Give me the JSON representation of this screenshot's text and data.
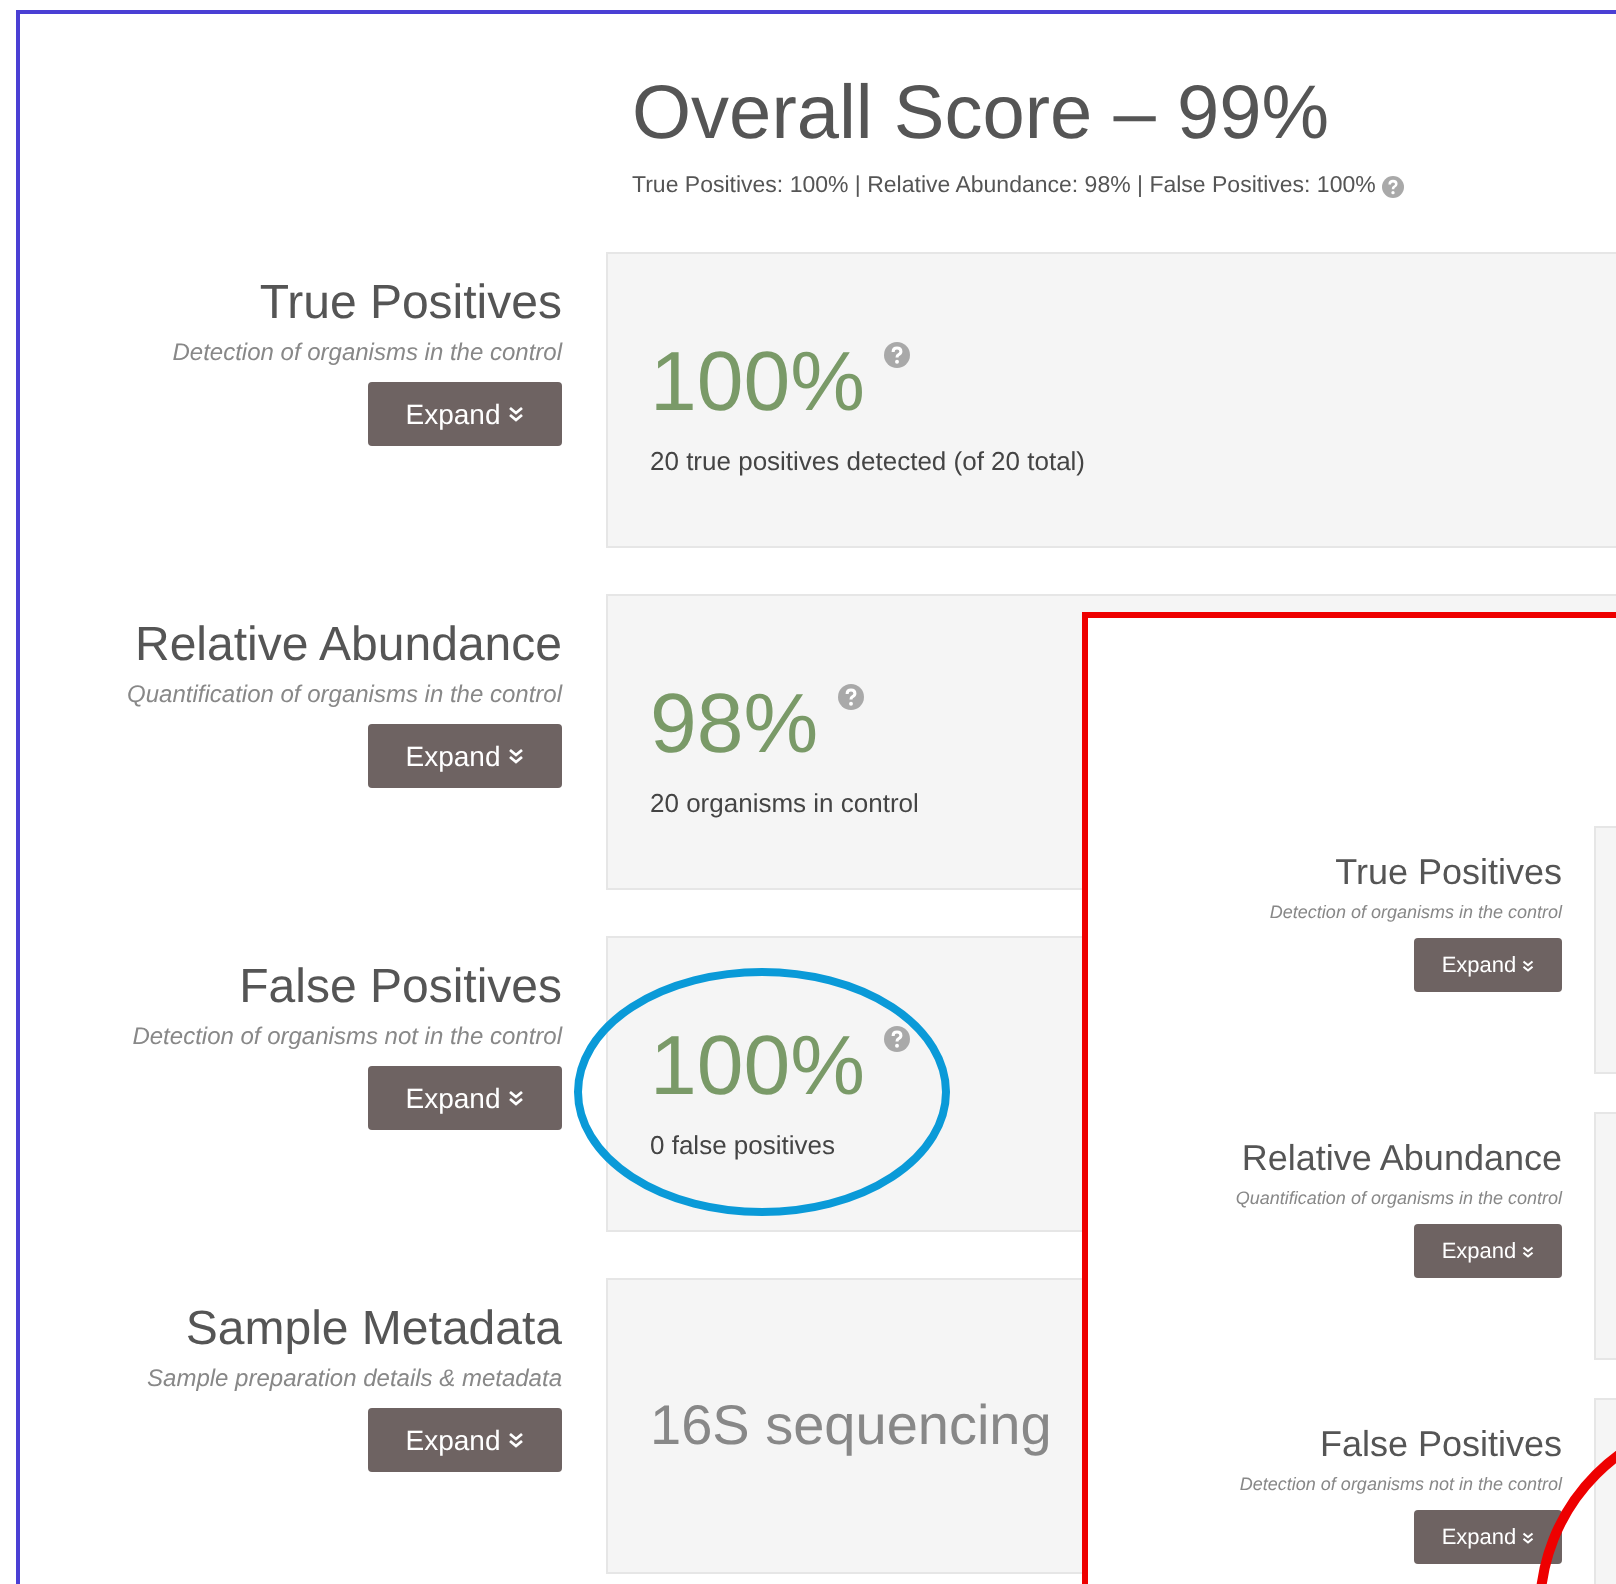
{
  "header": {
    "title": "Overall Score – 99%",
    "summary": "True Positives: 100% | Relative Abundance: 98% | False Positives: 100%"
  },
  "sections": [
    {
      "kind": "score",
      "title": "True Positives",
      "subtitle": "Detection of organisms in the control",
      "button": "Expand",
      "score": "100%",
      "detail": "20 true positives detected (of 20 total)",
      "highlighted": false
    },
    {
      "kind": "score",
      "title": "Relative Abundance",
      "subtitle": "Quantification of organisms in the control",
      "button": "Expand",
      "score": "98%",
      "detail": "20 organisms in control",
      "highlighted": false
    },
    {
      "kind": "score",
      "title": "False Positives",
      "subtitle": "Detection of organisms not in the control",
      "button": "Expand",
      "score": "100%",
      "detail": "0 false positives",
      "highlighted": true
    },
    {
      "kind": "text",
      "title": "Sample Metadata",
      "subtitle": "Sample preparation details & metadata",
      "button": "Expand",
      "value": "16S sequencing"
    }
  ],
  "inset": {
    "sections": [
      {
        "title": "True Positives",
        "subtitle": "Detection of organisms in the control",
        "button": "Expand",
        "highlighted": false
      },
      {
        "title": "Relative Abundance",
        "subtitle": "Quantification of organisms in the control",
        "button": "Expand",
        "highlighted": false
      },
      {
        "title": "False Positives",
        "subtitle": "Detection of organisms not in the control",
        "button": "Expand",
        "highlighted": true
      }
    ]
  }
}
